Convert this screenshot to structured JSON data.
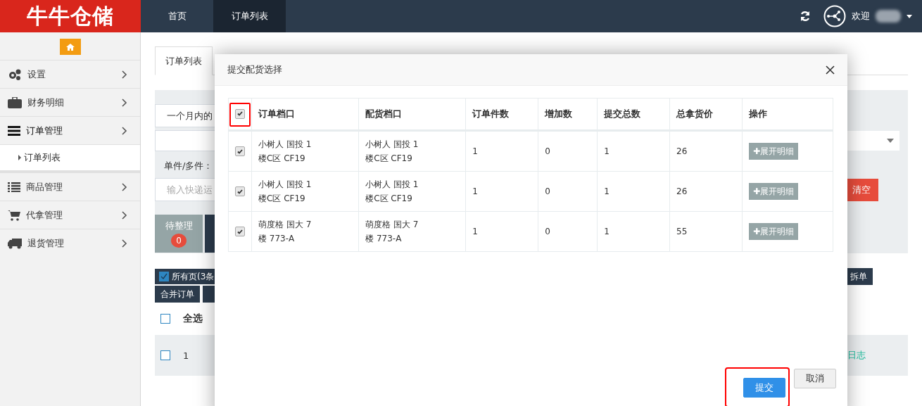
{
  "header": {
    "logo": "牛牛仓储",
    "nav": [
      {
        "label": "首页",
        "selected": false
      },
      {
        "label": "订单列表",
        "selected": true
      }
    ],
    "welcome": "欢迎"
  },
  "sidebar": {
    "items": [
      {
        "label": "设置",
        "expanded": false
      },
      {
        "label": "财务明细",
        "expanded": false
      },
      {
        "label": "订单管理",
        "expanded": true,
        "children": [
          {
            "label": "订单列表",
            "selected": true
          }
        ]
      },
      {
        "label": "商品管理",
        "expanded": false
      },
      {
        "label": "代拿管理",
        "expanded": false
      },
      {
        "label": "退货管理",
        "expanded": false
      }
    ]
  },
  "page": {
    "tab": "订单列表",
    "date_filter": "一个月内的",
    "piece_label": "单件/多件：",
    "tracking_placeholder": "输入快递运",
    "clear_button": "清空",
    "status_tile": {
      "label": "待整理",
      "count": "0"
    },
    "all_pages": {
      "label": "所有页(3条",
      "checked": true
    },
    "merge_button": "合并订单",
    "split_button": "拆单",
    "select_all": {
      "label": "全选",
      "checked": false
    },
    "order_row": {
      "index": "1",
      "checked": false,
      "log_link": "日志"
    }
  },
  "modal": {
    "title": "提交配货选择",
    "select_all": {
      "checked": true,
      "highlighted": true
    },
    "columns": [
      "订单档口",
      "配货档口",
      "订单件数",
      "增加数",
      "提交总数",
      "总拿货价",
      "操作"
    ],
    "rows": [
      {
        "checked": true,
        "order_stall": "小树人 国投 1 楼C区 CF19",
        "dist_stall": "小树人 国投 1 楼C区 CF19",
        "order_count": "1",
        "added": "0",
        "total": "1",
        "price": "26",
        "action": "✚展开明细"
      },
      {
        "checked": true,
        "order_stall": "小树人 国投 1 楼C区 CF19",
        "dist_stall": "小树人 国投 1 楼C区 CF19",
        "order_count": "1",
        "added": "0",
        "total": "1",
        "price": "26",
        "action": "✚展开明细"
      },
      {
        "checked": true,
        "order_stall": "萌度格 国大 7 楼 773-A",
        "dist_stall": "萌度格 国大 7 楼 773-A",
        "order_count": "1",
        "added": "0",
        "total": "1",
        "price": "55",
        "action": "✚展开明细"
      }
    ],
    "buttons": [
      {
        "label": "提交",
        "kind": "primary",
        "highlighted": true
      },
      {
        "label": "取消",
        "kind": "default",
        "highlighted": false
      }
    ]
  }
}
